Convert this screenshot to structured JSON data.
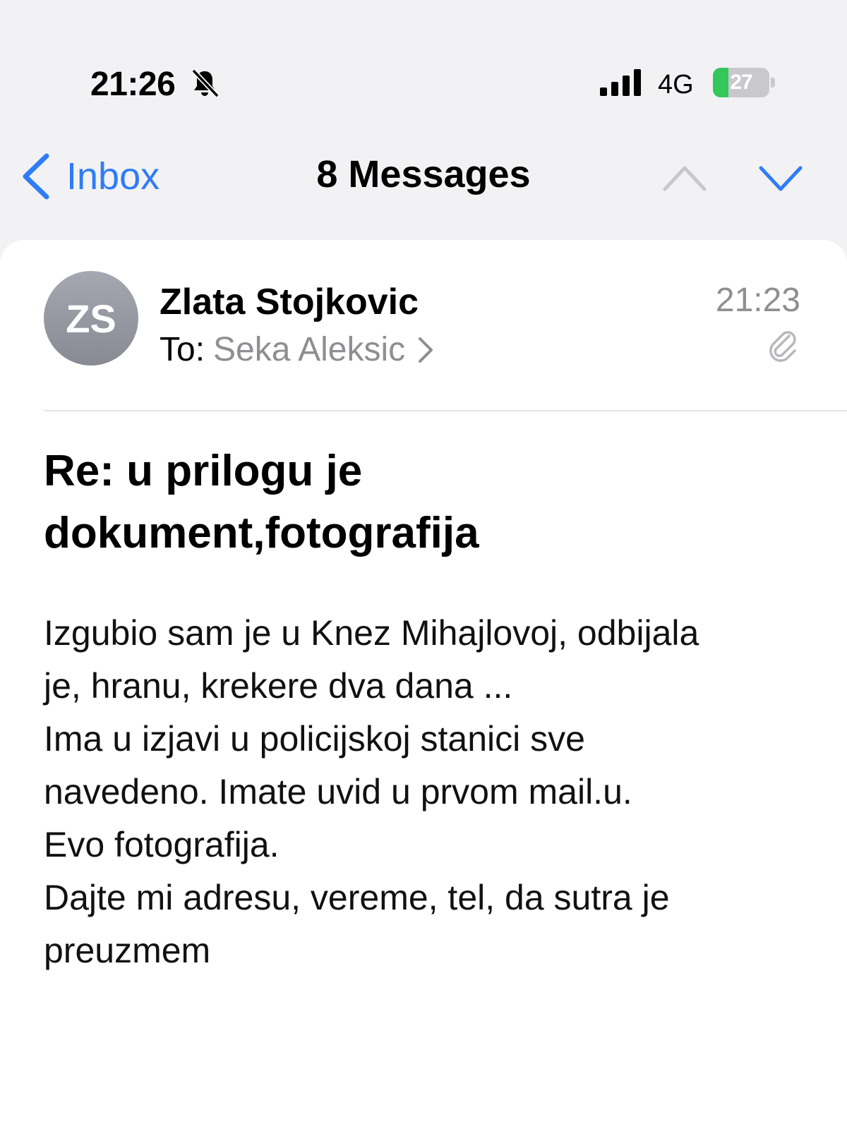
{
  "status_bar": {
    "time": "21:26",
    "network": "4G",
    "battery_level": "27",
    "battery_fraction": 0.27,
    "icons": [
      "bell-slash-icon",
      "signal-icon",
      "battery-charging-icon"
    ]
  },
  "nav": {
    "back_label": "Inbox",
    "title": "8 Messages",
    "icons": [
      "chevron-left-icon",
      "chevron-up-icon",
      "chevron-down-icon"
    ]
  },
  "message": {
    "avatar_initials": "ZS",
    "sender": "Zlata Stojkovic",
    "to_label": "To:",
    "recipient": "Seka Aleksic",
    "time": "21:23",
    "subject_lines": [
      "Re: u prilogu je",
      "dokument,fotografija"
    ],
    "body_lines": [
      "Izgubio sam je u Knez Mihajlovoj, odbijala",
      "je, hranu, krekere dva dana ...",
      "Ima u izjavi u policijskoj stanici sve",
      "navedeno. Imate uvid u prvom mail.u.",
      "Evo fotografija.",
      "Dajte mi adresu, vereme, tel, da sutra je",
      "preuzmem"
    ]
  },
  "colors": {
    "accent": "#2f7cf6",
    "secondary_text": "#8e8e93",
    "battery_green": "#34c759",
    "background": "#f2f2f4"
  }
}
